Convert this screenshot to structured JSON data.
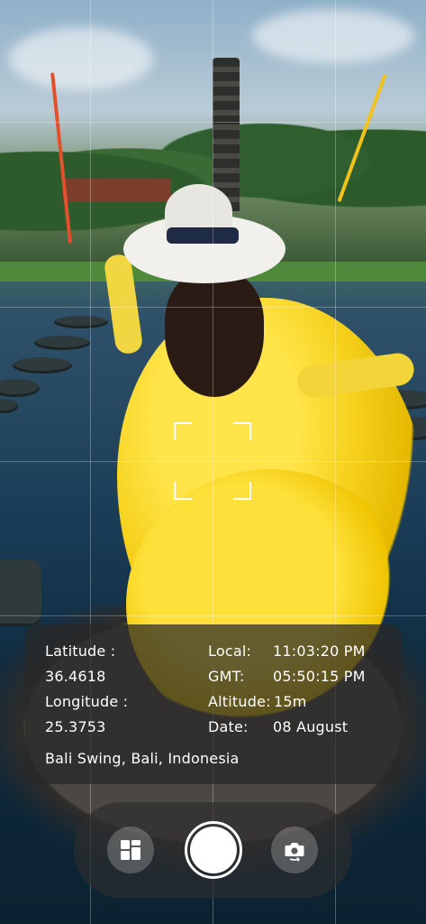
{
  "info": {
    "latitude_label": "Latitude :",
    "latitude_value": "36.4618",
    "longitude_label": "Longitude :",
    "longitude_value": "25.3753",
    "local_label": "Local:",
    "local_value": "11:03:20 PM",
    "gmt_label": "GMT:",
    "gmt_value": "05:50:15 PM",
    "altitude_label": "Altitude:",
    "altitude_value": "15m",
    "date_label": "Date:",
    "date_value": "08 August",
    "location": "Bali Swing, Bali, Indonesia"
  },
  "controls": {
    "gallery_icon": "grid-icon",
    "shutter_icon": "shutter",
    "switch_camera_icon": "camera-switch-icon"
  },
  "colors": {
    "card_bg": "#282828",
    "text": "#ffffff"
  }
}
